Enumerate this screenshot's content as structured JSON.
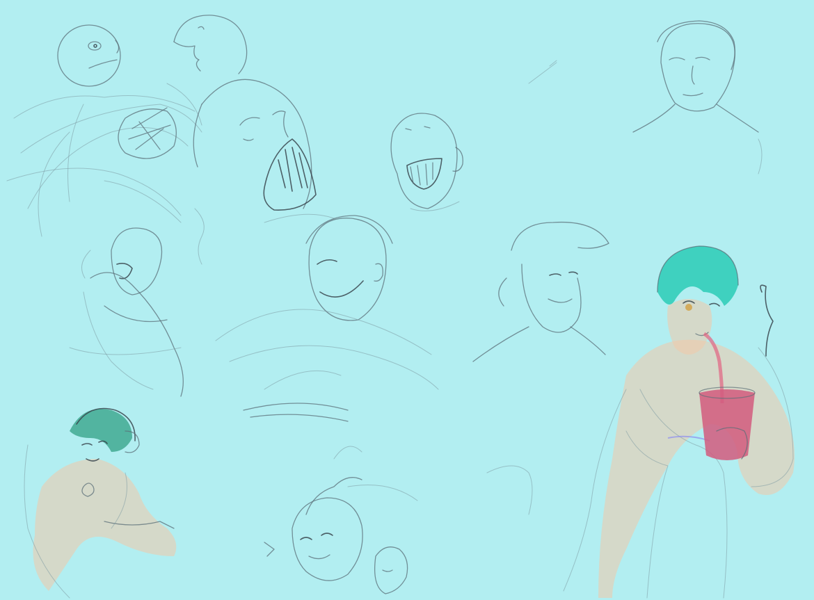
{
  "image": {
    "type": "sketch-page",
    "colors": {
      "background": "#b2eef1",
      "pencil": "#5b6f78",
      "pencil_dark": "#39474f",
      "skin": "#f2c9a8",
      "hair_teal": "#3fd1bf",
      "hair_green": "#3aa58c",
      "cup": "#d25a7e",
      "straw": "#e06a86",
      "dress_accent": "#8f8ff0"
    }
  }
}
